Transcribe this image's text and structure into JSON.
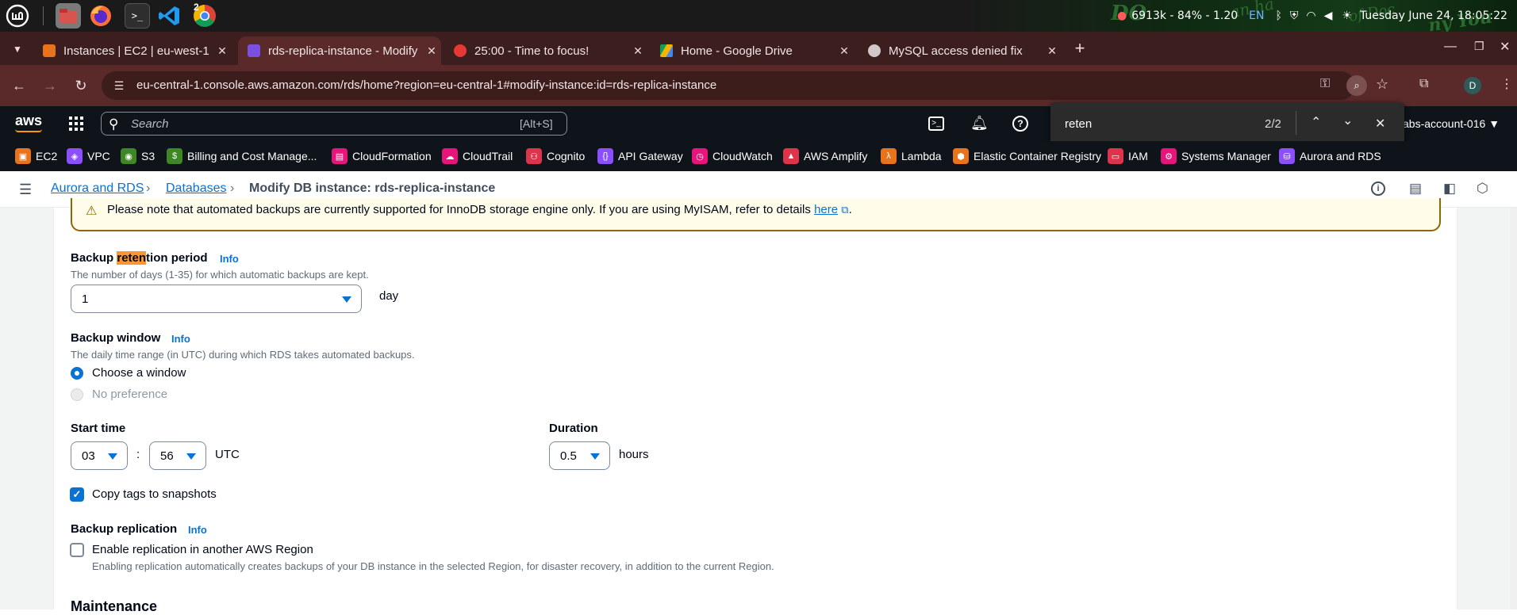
{
  "os": {
    "badge": "2",
    "tray_stats": "6913k - 84% - 1.20",
    "lang": "EN",
    "clock": "Tuesday June 24, 18:05:22"
  },
  "browser": {
    "tabs": [
      {
        "label": "Instances | EC2 | eu-west-1",
        "color": "#e8731a"
      },
      {
        "label": "rds-replica-instance - Modify",
        "color": "#7b4fe0"
      },
      {
        "label": "25:00 - Time to focus!",
        "color": "#e53935"
      },
      {
        "label": "Home - Google Drive",
        "color": "#1a73e8"
      },
      {
        "label": "MySQL access denied fix",
        "color": "#d0c8c8"
      }
    ],
    "url": "eu-central-1.console.aws.amazon.com/rds/home?region=eu-central-1#modify-instance:id=rds-replica-instance",
    "avatar_letter": "D"
  },
  "aws_header": {
    "logo": "aws",
    "search_placeholder": "Search",
    "search_shortcut": "[Alt+S]",
    "account": "abs-account-016"
  },
  "find_bar": {
    "query": "reten",
    "count": "2/2"
  },
  "bookmarks": [
    {
      "label": "EC2",
      "color": "#e8731a"
    },
    {
      "label": "VPC",
      "color": "#8c4fff"
    },
    {
      "label": "S3",
      "color": "#3f8624"
    },
    {
      "label": "Billing and Cost Manage...",
      "color": "#3f8624"
    },
    {
      "label": "CloudFormation",
      "color": "#e7157b"
    },
    {
      "label": "CloudTrail",
      "color": "#e7157b"
    },
    {
      "label": "Cognito",
      "color": "#dd344c"
    },
    {
      "label": "API Gateway",
      "color": "#8c4fff"
    },
    {
      "label": "CloudWatch",
      "color": "#e7157b"
    },
    {
      "label": "AWS Amplify",
      "color": "#dd344c"
    },
    {
      "label": "Lambda",
      "color": "#e8731a"
    },
    {
      "label": "Elastic Container Registry",
      "color": "#e8731a"
    },
    {
      "label": "IAM",
      "color": "#dd344c"
    },
    {
      "label": "Systems Manager",
      "color": "#e7157b"
    },
    {
      "label": "Aurora and RDS",
      "color": "#8c4fff"
    }
  ],
  "breadcrumb": {
    "root": "Aurora and RDS",
    "databases": "Databases",
    "current": "Modify DB instance: rds-replica-instance"
  },
  "warning": {
    "text": "Please note that automated backups are currently supported for InnoDB storage engine only. If you are using MyISAM, refer to details",
    "link": "here",
    "end": "."
  },
  "backup_retention": {
    "label_pre": "Backup ",
    "label_hl": "reten",
    "label_post": "tion period",
    "info": "Info",
    "description": "The number of days (1-35) for which automatic backups are kept.",
    "value": "1",
    "unit": "day"
  },
  "backup_window": {
    "label": "Backup window",
    "info": "Info",
    "description": "The daily time range (in UTC) during which RDS takes automated backups.",
    "option_choose": "Choose a window",
    "option_none": "No preference",
    "selected": "Choose a window"
  },
  "start_time": {
    "label": "Start time",
    "hour": "03",
    "separator": ":",
    "minute": "56",
    "tz": "UTC"
  },
  "duration": {
    "label": "Duration",
    "value": "0.5",
    "unit": "hours"
  },
  "copy_tags": {
    "label": "Copy tags to snapshots",
    "checked": true
  },
  "backup_replication": {
    "label": "Backup replication",
    "info": "Info",
    "checkbox_label": "Enable replication in another AWS Region",
    "checked": false,
    "description": "Enabling replication automatically creates backups of your DB instance in the selected Region, for disaster recovery, in addition to the current Region."
  },
  "next_section": "Maintenance"
}
